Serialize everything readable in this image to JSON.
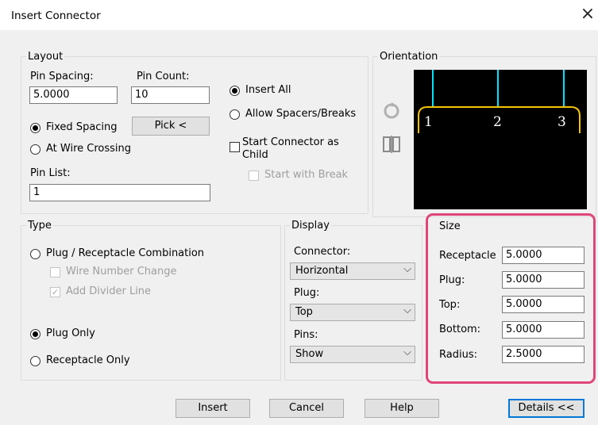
{
  "window": {
    "title": "Insert Connector",
    "close_glyph": "×"
  },
  "layout": {
    "legend": "Layout",
    "pin_spacing_label": "Pin Spacing:",
    "pin_spacing_value": "5.0000",
    "pin_count_label": "Pin Count:",
    "pin_count_value": "10",
    "fixed_spacing_label": "Fixed Spacing",
    "pick_button": "Pick <",
    "at_wire_crossing_label": "At Wire Crossing",
    "pin_list_label": "Pin List:",
    "pin_list_value": "1",
    "insert_all_label": "Insert All",
    "allow_spacers_label": "Allow Spacers/Breaks",
    "start_connector_child_label_1": "Start Connector as",
    "start_connector_child_label_2": "Child",
    "start_with_break_label": "Start with Break",
    "selected_mode": "Fixed Spacing",
    "selected_insert": "Insert All"
  },
  "orientation": {
    "legend": "Orientation",
    "pins": [
      "1",
      "2",
      "3"
    ],
    "rotate_icon": "rotate-icon",
    "flip_icon": "flip-icon",
    "preview_colors": {
      "background": "#000000",
      "connector": "#f5c400",
      "wire": "#00e5ff",
      "text": "#ffffff"
    }
  },
  "type": {
    "legend": "Type",
    "plug_receptacle_combo_label": "Plug / Receptacle Combination",
    "wire_number_change_label": "Wire Number Change",
    "add_divider_line_label": "Add Divider Line",
    "add_divider_line_checked": true,
    "plug_only_label": "Plug Only",
    "receptacle_only_label": "Receptacle Only",
    "selected": "Plug Only"
  },
  "display": {
    "legend": "Display",
    "connector_label": "Connector:",
    "connector_value": "Horizontal",
    "plug_label": "Plug:",
    "plug_value": "Top",
    "pins_label": "Pins:",
    "pins_value": "Show"
  },
  "size": {
    "legend": "Size",
    "receptacle_label": "Receptacle",
    "receptacle_value": "5.0000",
    "plug_label": "Plug:",
    "plug_value": "5.0000",
    "top_label": "Top:",
    "top_value": "5.0000",
    "bottom_label": "Bottom:",
    "bottom_value": "5.0000",
    "radius_label": "Radius:",
    "radius_value": "2.5000",
    "highlight_color": "#e0457a"
  },
  "footer": {
    "insert_button": "Insert",
    "cancel_button": "Cancel",
    "help_button": "Help",
    "details_button": "Details <<"
  }
}
